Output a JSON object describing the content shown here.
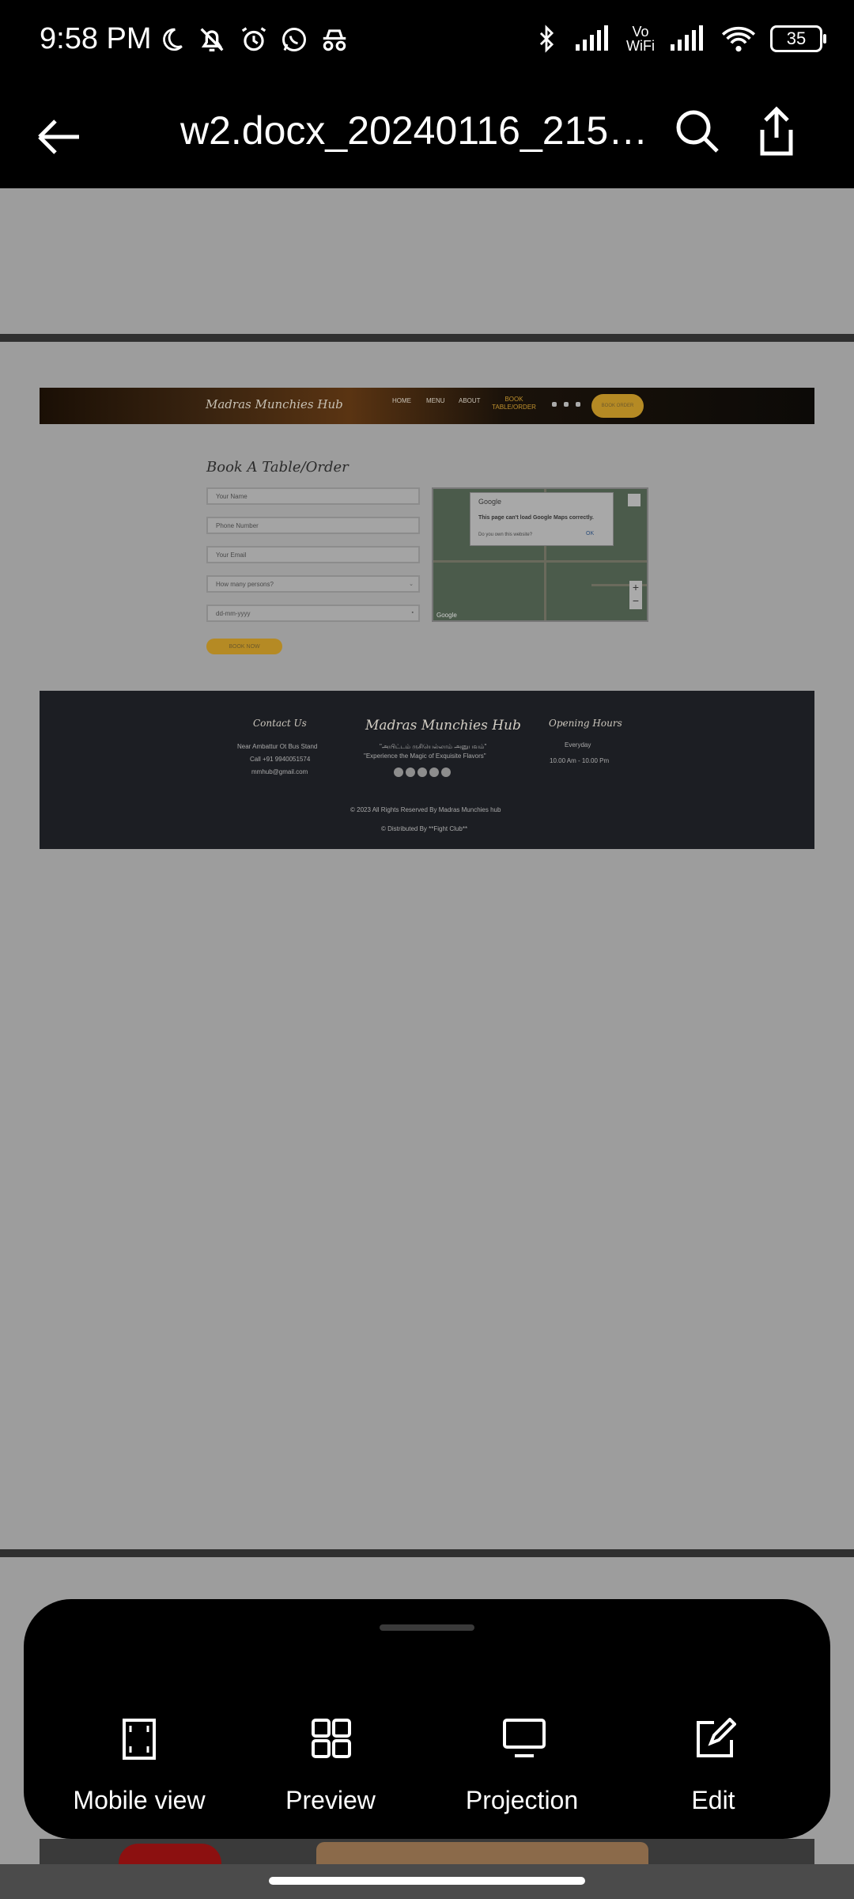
{
  "status_bar": {
    "time": "9:58 PM",
    "vowifi": "Vo\nWiFi",
    "battery": "35"
  },
  "app_bar": {
    "title": "w2.docx_20240116_2155..."
  },
  "document": {
    "nav": {
      "logo": "Madras Munchies Hub",
      "links": [
        "HOME",
        "MENU",
        "ABOUT"
      ],
      "book": "BOOK TABLE/ORDER",
      "cta": "BOOK ORDER"
    },
    "form": {
      "title": "Book A Table/Order",
      "name_placeholder": "Your Name",
      "phone_placeholder": "Phone Number",
      "email_placeholder": "Your Email",
      "persons_placeholder": "How many persons?",
      "date_placeholder": "dd-mm-yyyy",
      "submit": "BOOK NOW"
    },
    "map": {
      "provider": "Google",
      "error": "This page can't load Google Maps correctly.",
      "question": "Do you own this website?",
      "ok": "OK",
      "watermark": "Google"
    },
    "footer": {
      "contact_title": "Contact Us",
      "address": "Near Ambattur Ot Bus Stand",
      "phone": "Call +91 9940051574",
      "email": "mmhub@gmail.com",
      "logo": "Madras Munchies Hub",
      "tagline_tamil": "\"அயிட்டம் ருசியெல்லாம் அனுபவம்\"",
      "tagline": "\"Experience the Magic of Exquisite Flavors\"",
      "hours_title": "Opening Hours",
      "hours_days": "Everyday",
      "hours_time": "10.00 Am - 10.00 Pm",
      "copyright": "© 2023 All Rights Reserved By Madras Munchies hub",
      "distributed": "© Distributed By **Fight Club**"
    }
  },
  "bottom_sheet": {
    "items": [
      {
        "label": "Mobile view",
        "icon": "mobile-view-icon"
      },
      {
        "label": "Preview",
        "icon": "grid-icon"
      },
      {
        "label": "Projection",
        "icon": "monitor-icon"
      },
      {
        "label": "Edit",
        "icon": "edit-icon"
      }
    ]
  }
}
